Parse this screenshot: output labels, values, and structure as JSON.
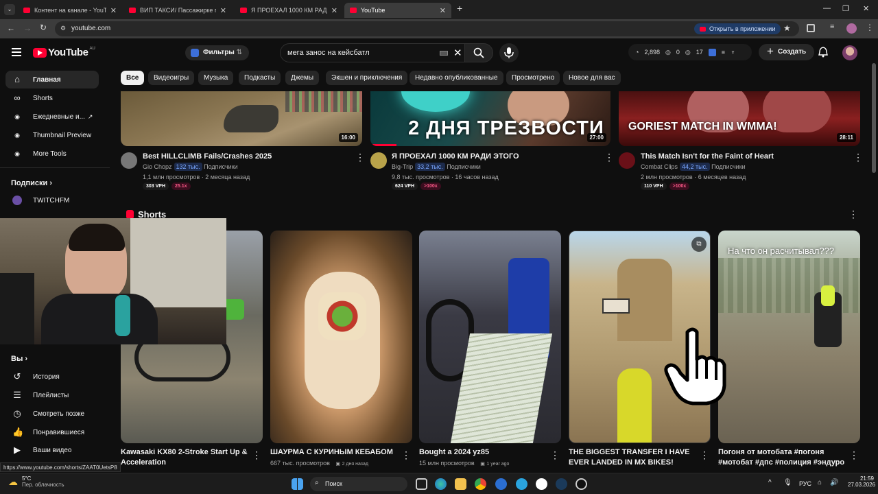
{
  "browser": {
    "tabs": [
      {
        "label": "Контент на канале - YouTube Studio"
      },
      {
        "label": "ВИП ТАКСИ/ Пассажирке пон..."
      },
      {
        "label": "Я ПРОЕХАЛ 1000 КМ РАДИ ЭТ..."
      },
      {
        "label": "YouTube"
      }
    ],
    "url": "youtube.com",
    "open_in_app": "Открыть в приложении"
  },
  "header": {
    "logo": "YouTube",
    "country_code": "AU",
    "filters_label": "Фильтры",
    "search_query": "мега занос на кейсбатл",
    "stats": {
      "views": "2,898",
      "a": "0",
      "b": "17"
    },
    "create_label": "Создать"
  },
  "sidebar": {
    "items": [
      {
        "label": "Главная",
        "icon": "home-icon"
      },
      {
        "label": "Shorts",
        "icon": "shorts-icon"
      },
      {
        "label": "Ежедневные и...",
        "icon": "extension-icon"
      },
      {
        "label": "Thumbnail Preview",
        "icon": "extension-icon"
      },
      {
        "label": "More Tools",
        "icon": "extension-icon"
      }
    ],
    "subs_heading": "Подписки",
    "subs": [
      {
        "label": "TWITCHFM"
      }
    ],
    "you_heading": "Вы",
    "you_items": [
      {
        "label": "История",
        "icon": "history-icon"
      },
      {
        "label": "Плейлисты",
        "icon": "playlists-icon"
      },
      {
        "label": "Смотреть позже",
        "icon": "clock-icon"
      },
      {
        "label": "Понравившиеся",
        "icon": "thumbs-up-icon"
      },
      {
        "label": "Ваши видео",
        "icon": "video-icon"
      }
    ]
  },
  "chips": [
    "Все",
    "Видеоигры",
    "Музыка",
    "Подкасты",
    "Джемы",
    "Экшен и приключения",
    "Недавно опубликованные",
    "Просмотрено",
    "Новое для вас"
  ],
  "videos": [
    {
      "title": "Best HILLCLIMB Fails/Crashes 2025",
      "channel": "Gio Chopz",
      "subs": "132 тыс.",
      "subs_label": "Подписчики",
      "meta": "1,1 млн просмотров · 2 месяца назад",
      "vph": "303 VPH",
      "mult": "25.1x",
      "duration": "16:00"
    },
    {
      "title": "Я ПРОЕХАЛ 1000 КМ РАДИ ЭТОГО",
      "channel": "Big-Trip",
      "subs": "33,2 тыс.",
      "subs_label": "Подписчики",
      "meta": "9,8 тыс. просмотров · 16 часов назад",
      "vph": "624 VPH",
      "mult": ">100x",
      "duration": "27:00",
      "thumb_text": "2 ДНЯ ТРЕЗВОСТИ"
    },
    {
      "title": "This Match Isn't for the Faint of Heart",
      "channel": "Combat Clips",
      "subs": "44,2 тыс.",
      "subs_label": "Подписчики",
      "meta": "2 млн просмотров · 6 месяцев назад",
      "vph": "110 VPH",
      "mult": ">100x",
      "duration": "28:11",
      "thumb_text": "GORIEST MATCH IN WMMA!"
    }
  ],
  "shorts": {
    "heading": "Shorts",
    "items": [
      {
        "title": "Kawasaki KX80 2-Stroke Start Up & Acceleration",
        "meta": ""
      },
      {
        "title": "ШАУРМА С КУРИНЫМ КЕБАБОМ",
        "meta": "667 тыс. просмотров",
        "date": "2 дня назад"
      },
      {
        "title": "Bought a 2024 yz85",
        "meta": "15 млн просмотров",
        "date": "1 year ago"
      },
      {
        "title": "THE BIGGEST TRANSFER I HAVE EVER LANDED IN MX BIKES!",
        "meta": ""
      },
      {
        "title": "Погоня от мотобата #погоня #мотобат #дпс #полиция #эндуро ...",
        "meta": "",
        "overlay": "На что он расчитывал???"
      }
    ]
  },
  "status_url": "https://www.youtube.com/shorts/ZAAT0UetsP8",
  "taskbar": {
    "weather_temp": "5°C",
    "weather_desc": "Пер. облачность",
    "search_label": "Поиск",
    "lang": "РУС",
    "time": "21:59",
    "date": "27.03.2026"
  }
}
